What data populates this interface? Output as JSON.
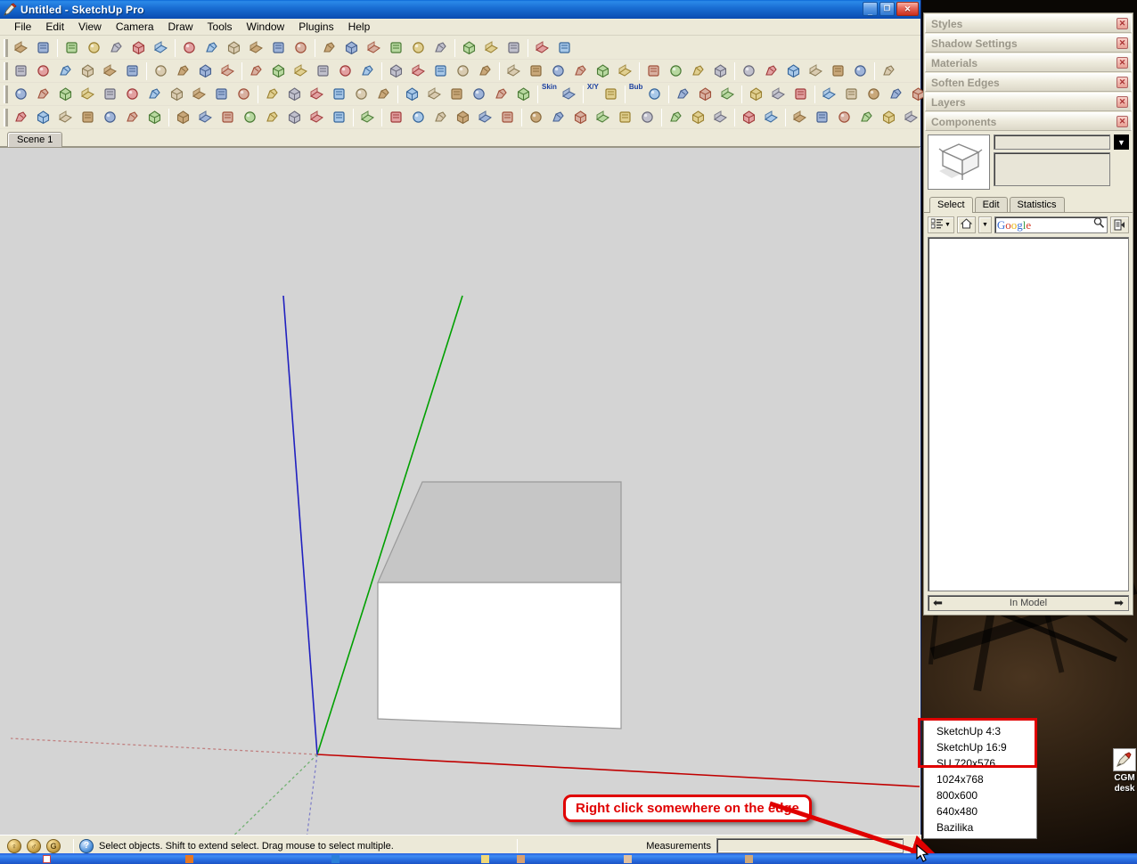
{
  "window": {
    "title": "Untitled - SketchUp Pro",
    "app_icon": "sketchup-pencil-icon",
    "controls": {
      "minimize": "_",
      "maximize": "□",
      "close": "✕"
    }
  },
  "menubar": {
    "items": [
      "File",
      "Edit",
      "View",
      "Camera",
      "Draw",
      "Tools",
      "Window",
      "Plugins",
      "Help"
    ]
  },
  "toolbars": {
    "rows": [
      {
        "groups": [
          {
            "icons": [
              "new-file-icon",
              "open-file-icon"
            ]
          },
          {
            "icons": [
              "save-icon",
              "print-icon",
              "preview-icon",
              "model-info-icon",
              "erase-icon"
            ]
          },
          {
            "icons": [
              "cut-icon",
              "copy-icon",
              "paste-icon",
              "undo-copy-icon",
              "group-icon",
              "component-icon"
            ]
          },
          {
            "icons": [
              "paint-bucket-icon",
              "dimension-icon",
              "move-up-icon",
              "move-down-icon",
              "scale-line-icon",
              "xray-icon"
            ]
          },
          {
            "icons": [
              "undo-icon",
              "redo-icon",
              "history-icon"
            ]
          },
          {
            "icons": [
              "layer-page-icon",
              "pencil-edit-icon"
            ]
          }
        ]
      },
      {
        "groups": [
          {
            "icons": [
              "select-arrow-icon",
              "eraser-icon",
              "paint-bucket-icon",
              "pencil-icon",
              "freehand-icon",
              "arc-icon"
            ]
          },
          {
            "icons": [
              "rectangle-icon",
              "circle-icon",
              "polygon-icon",
              "text-icon"
            ]
          },
          {
            "icons": [
              "move-icon",
              "push-pull-icon",
              "rotate-icon",
              "follow-me-icon",
              "scale-icon",
              "offset-icon"
            ]
          },
          {
            "icons": [
              "tape-measure-icon",
              "dimension-icon",
              "protractor-icon",
              "axes-icon",
              "3d-text-icon"
            ]
          },
          {
            "icons": [
              "orbit-icon",
              "pan-icon",
              "zoom-icon",
              "zoom-extents-icon",
              "zoom-window-icon",
              "previous-view-icon"
            ]
          },
          {
            "icons": [
              "position-camera-icon",
              "walk-icon",
              "look-around-icon",
              "section-plane-icon"
            ]
          },
          {
            "icons": [
              "shade-face-icon",
              "shade-texture-icon",
              "shade-monochrome-icon",
              "wireframe-icon",
              "hidden-line-icon",
              "xray-shade-icon"
            ]
          },
          {
            "icons": [
              "sandbox-smoove-icon"
            ]
          }
        ]
      },
      {
        "groups": [
          {
            "icons": [
              "arc-tool-icon",
              "arc2-icon",
              "arc3-icon",
              "bezier-icon",
              "curve-icon",
              "ellipse-icon",
              "spiral-icon",
              "helix-icon",
              "arc-seg-icon",
              "arc-offset-icon",
              "round-corner-icon"
            ]
          },
          {
            "icons": [
              "line-divide-icon",
              "weld-icon",
              "key-icon",
              "loft-icon",
              "sweep-icon",
              "shell-icon"
            ]
          },
          {
            "icons": [
              "grid-icon",
              "stipple-icon",
              "letter-a-icon",
              "slice-icon",
              "mesh-icon",
              "plane-icon"
            ]
          },
          {
            "label": "Skin",
            "icons": [
              "skin-mouse-icon"
            ]
          },
          {
            "label": "X/Y",
            "icons": [
              "xy-mouse-icon"
            ]
          },
          {
            "label": "Bub",
            "icons": [
              "bub-mouse-icon"
            ]
          },
          {
            "icons": [
              "play-icon",
              "stop-icon",
              "help-blue-icon"
            ]
          },
          {
            "icons": [
              "sphere-wire1-icon",
              "sphere-wire2-icon",
              "sphere-solid-icon"
            ]
          },
          {
            "icons": [
              "layer-blue-icon",
              "pill-icon",
              "orange-ball-icon",
              "window-grid-icon",
              "panel-icon",
              "help-green-icon"
            ]
          },
          {
            "icons": [
              "refresh-icon",
              "arc-gray-icon"
            ]
          }
        ]
      },
      {
        "groups": [
          {
            "icons": [
              "down-arrow-icon",
              "scatter-icon",
              "brush-icon",
              "camera-icon",
              "bug-icon",
              "tree-icon",
              "paint-roller-icon"
            ]
          },
          {
            "icons": [
              "book-icon",
              "home-icon",
              "window-white-icon",
              "door-icon",
              "flag-icon",
              "black-square-icon",
              "cabinet-icon",
              "exit-icon"
            ]
          },
          {
            "icons": [
              "info-blue-icon"
            ]
          },
          {
            "icons": [
              "pin-red-icon",
              "pin-blue-icon",
              "zoom-target-icon",
              "stopwatch-icon",
              "eye-icon",
              "head-icon"
            ]
          },
          {
            "icons": [
              "cube-gray1-icon",
              "cube-gray2-icon",
              "cube-gray3-icon",
              "cube-dark-icon",
              "cube-stack-icon",
              "cube-light-icon"
            ]
          },
          {
            "icons": [
              "cube-yellow-icon",
              "cube-blue-icon",
              "cube-green-icon"
            ]
          },
          {
            "icons": [
              "intersect-icon",
              "split-icon"
            ]
          },
          {
            "icons": [
              "power-green-icon",
              "star-yellow-icon",
              "flash-icon",
              "chart-icon",
              "globe-icon",
              "gear-icon",
              "frame-green-icon"
            ]
          },
          {
            "icons": [
              "dome-gray-icon"
            ]
          }
        ]
      }
    ]
  },
  "scenes": {
    "tabs": [
      "Scene 1"
    ],
    "active": "Scene 1"
  },
  "viewport": {
    "background_color": "#d4d4d4",
    "axes": {
      "red": "#c00000",
      "green": "#00a000",
      "blue": "#2020c0"
    },
    "model": {
      "name": "box-model",
      "top_face_color": "#c6c6c6",
      "front_face_color": "#ffffff",
      "edge_color": "#808080"
    }
  },
  "callout": {
    "text": "Right click somewhere on the edge",
    "border_color": "#e00000",
    "text_color": "#e00000",
    "arrow_color": "#e00000"
  },
  "statusbar": {
    "icons": [
      "credit-coin-1-icon",
      "credit-coin-2-icon",
      "credit-coin-3-icon"
    ],
    "help_icon": "question-mark-icon",
    "hint": "Select objects. Shift to extend select. Drag mouse to select multiple.",
    "measurements_label": "Measurements",
    "measurements_value": "",
    "resize_grip": "resize-grip-icon"
  },
  "tray": {
    "panels": [
      {
        "label": "Styles",
        "collapsed": true,
        "close_icon": "panel-close-icon"
      },
      {
        "label": "Shadow Settings",
        "collapsed": true,
        "close_icon": "panel-close-icon"
      },
      {
        "label": "Materials",
        "collapsed": true,
        "close_icon": "panel-close-icon"
      },
      {
        "label": "Soften Edges",
        "collapsed": true,
        "close_icon": "panel-close-icon"
      },
      {
        "label": "Layers",
        "collapsed": true,
        "close_icon": "panel-close-icon"
      },
      {
        "label": "Components",
        "collapsed": false,
        "close_icon": "panel-close-icon"
      }
    ],
    "components": {
      "thumbnail": "component-preview-icon",
      "name_value": "",
      "description_value": "",
      "detail_button_icon": "component-details-icon",
      "tabs": [
        {
          "label": "Select",
          "active": true
        },
        {
          "label": "Edit",
          "active": false
        },
        {
          "label": "Statistics",
          "active": false
        }
      ],
      "view_options_icon": "view-list-icon",
      "view_options_caret": "chevron-down-icon",
      "home_icon": "home-icon",
      "home_caret": "chevron-down-icon",
      "search_placeholder": "Google",
      "search_value": "",
      "search_icon": "magnifier-icon",
      "details_icon": "details-flyout-icon",
      "nav_back_icon": "arrow-left-icon",
      "nav_forward_icon": "arrow-right-icon",
      "library_label": "In Model"
    }
  },
  "context_menu": {
    "items": [
      {
        "label": "SketchUp 4:3",
        "highlighted": true
      },
      {
        "label": "SketchUp 16:9",
        "highlighted": true
      },
      {
        "label": "SU 720x576",
        "highlighted": true
      },
      {
        "label": "1024x768",
        "highlighted": false
      },
      {
        "label": "800x600",
        "highlighted": false
      },
      {
        "label": "640x480",
        "highlighted": false
      },
      {
        "label": "Bazilika",
        "highlighted": false
      }
    ],
    "highlight_color": "#e00000"
  },
  "desktop": {
    "icon": {
      "name": "cgm-desk-shortcut-icon",
      "label_line1": "CGM",
      "label_line2": "desk"
    }
  },
  "taskbar": {
    "items": [
      "",
      "",
      "",
      "",
      "",
      "",
      ""
    ]
  }
}
